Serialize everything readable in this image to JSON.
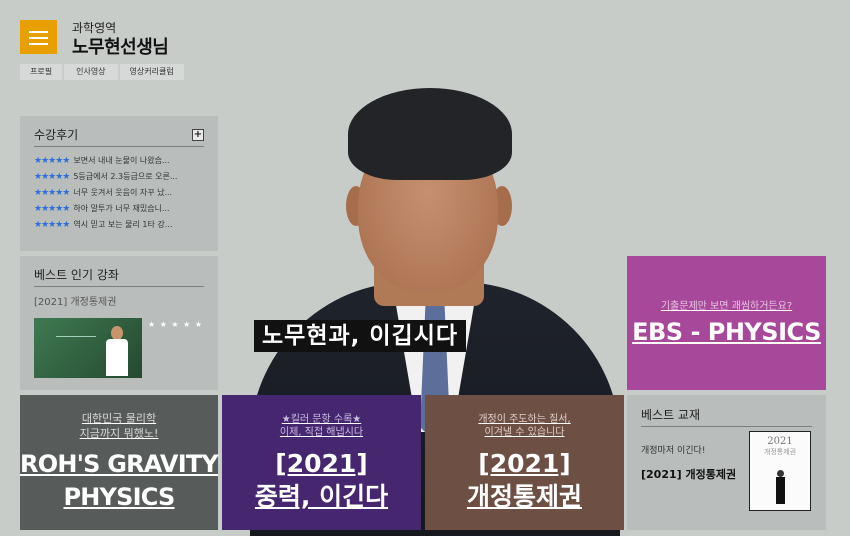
{
  "header": {
    "subtitle": "과학영역",
    "title": "노무현선생님"
  },
  "nav": {
    "items": [
      "프로필",
      "인사영상",
      "영상커리큘럼"
    ]
  },
  "reviews": {
    "title": "수강후기",
    "more_icon": "plus-icon",
    "items": [
      {
        "stars": "★★★★★",
        "text": "보면서 내내 눈물이 나왔습..."
      },
      {
        "stars": "★★★★★",
        "text": "5등급에서 2.3등급으로 오른..."
      },
      {
        "stars": "★★★★★",
        "text": "너무 웃겨서 웃음이 자꾸 났..."
      },
      {
        "stars": "★★★★★",
        "text": "하아 말투가 너무 재밌습니..."
      },
      {
        "stars": "★★★★★",
        "text": "역시 믿고 보는 물리 1타 강..."
      }
    ]
  },
  "best_lecture": {
    "title": "베스트 인기 강좌",
    "name": "[2021] 개정통제권",
    "stars": "★ ★ ★ ★ ★"
  },
  "hero": {
    "caption": "노무현과, 이깁시다"
  },
  "promos": {
    "ebs": {
      "sub": "기출문제만 보면 괘씸하거든요?",
      "main": "EBS - PHYSICS"
    },
    "gravity": {
      "sub1": "대한민국 물리학",
      "sub2": "지금까지 뭐했노!",
      "main1": "ROH'S GRAVITY",
      "main2": "PHYSICS"
    },
    "force": {
      "sub1": "★킬러 문항 수록★",
      "sub2": "이제, 직접 해냅시다",
      "main1": "[2021]",
      "main2": "중력, 이긴다"
    },
    "tome": {
      "sub1": "개정이 주도하는 질서,",
      "sub2": "이겨낼 수 있습니다",
      "main1": "[2021]",
      "main2": "개정통제권"
    }
  },
  "best_book": {
    "title": "베스트 교재",
    "text1": "개정마저 이긴다!",
    "text2": "[2021] 개정통제권",
    "cover_year": "2021",
    "cover_title": "개정통제권"
  },
  "colors": {
    "accent": "#e8a000",
    "ebs": "#a7489a",
    "gravity": "#575b5a",
    "force": "#46266f",
    "tome": "#6d4f44",
    "star": "#2e6fd8"
  }
}
